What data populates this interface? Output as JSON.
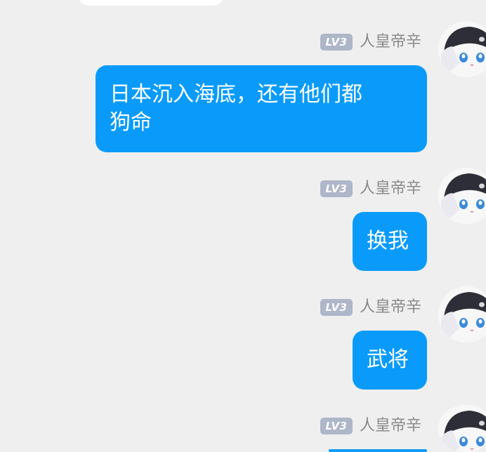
{
  "messages": [
    {
      "level": "LV3",
      "sender": "人皇帝辛",
      "text": "日本沉入海底，还有他们都\n狗命"
    },
    {
      "level": "LV3",
      "sender": "人皇帝辛",
      "text": "换我"
    },
    {
      "level": "LV3",
      "sender": "人皇帝辛",
      "text": "武将"
    },
    {
      "level": "LV3",
      "sender": "人皇帝辛",
      "text": ""
    }
  ],
  "colors": {
    "background": "#efefef",
    "bubble": "#0a9bfa",
    "badge": "#aeb6c9",
    "sender_text": "#8a8a8a"
  },
  "icons": {
    "avatar": "anime-avatar-icon"
  }
}
